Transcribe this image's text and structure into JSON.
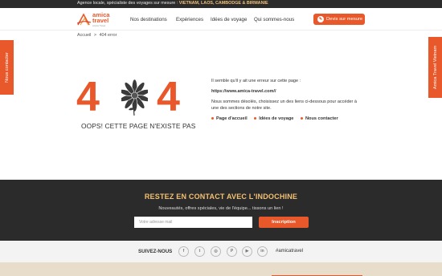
{
  "topbar": {
    "prefix": "Agence locale, spécialiste des voyages sur mesure : ",
    "highlight": "VIETNAM, LAOS, CAMBODGE & BIRMANIE"
  },
  "header": {
    "logo": {
      "line1": "amica",
      "line2": "travel",
      "tagline": "Amica Travel"
    },
    "nav": [
      {
        "label": "Nos destinations"
      },
      {
        "label": "Expériences"
      },
      {
        "label": "Idées de voyage"
      },
      {
        "label": "Qui sommes-nous"
      }
    ],
    "cta": "Devis sur mesure"
  },
  "breadcrumb": {
    "home": "Accueil",
    "sep": ">",
    "current": "404 error"
  },
  "side": {
    "left": "Nous contacter",
    "right": "Amica Travel Vietnam"
  },
  "error": {
    "digit_left": "4",
    "digit_right": "4",
    "headline": "OOPS! CETTE PAGE N'EXISTE PAS",
    "line1": "Il semble qu'il y ait une erreur sur cette page :",
    "url": "https://www.amica-travel.com//",
    "line2": "Nous sommes désolés, choisissez un des liens ci-dessous pour accéder à",
    "line3": "une des sections de notre site.",
    "links": [
      {
        "label": "Page d'accueil"
      },
      {
        "label": "Idées de voyage"
      },
      {
        "label": "Nous contacter"
      }
    ]
  },
  "contact": {
    "title": "RESTEZ EN CONTACT AVEC L'INDOCHINE",
    "subtitle": "Nouveautés, offres spéciales, vie de l'équipe... tissons un lien !",
    "email_placeholder": "Votre adresse mail",
    "subscribe": "Inscription"
  },
  "social": {
    "label": "SUIVEZ-NOUS",
    "icons": [
      {
        "name": "facebook-icon",
        "glyph": "f"
      },
      {
        "name": "twitter-icon",
        "glyph": "t"
      },
      {
        "name": "instagram-icon",
        "glyph": "◎"
      },
      {
        "name": "pinterest-icon",
        "glyph": "P"
      },
      {
        "name": "youtube-icon",
        "glyph": "▶"
      },
      {
        "name": "linkedin-icon",
        "glyph": "in"
      }
    ],
    "hashtag": "#amicatravel"
  },
  "colors": {
    "accent": "#e8582a",
    "dark": "#2b2b2b",
    "gold": "#f3c173"
  }
}
